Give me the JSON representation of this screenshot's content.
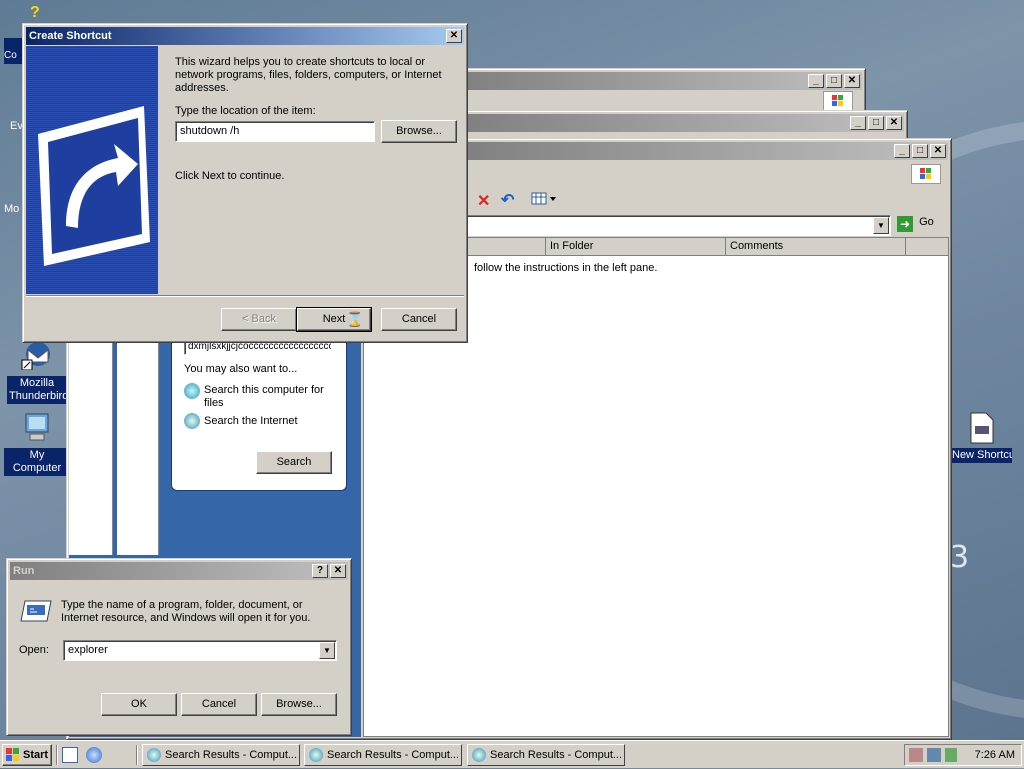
{
  "desktop": {
    "icons": [
      {
        "label": "Mozilla Thunderbird"
      },
      {
        "label": "My Computer"
      },
      {
        "label": "New Shortcut"
      }
    ],
    "partial_labels": [
      "Co",
      "Ev",
      "Mo"
    ],
    "background_digit": "3"
  },
  "search_windows": {
    "columns": [
      "In Folder",
      "Comments"
    ],
    "go_label": "Go",
    "results_message": "follow the instructions in the left pane.",
    "left_pane": {
      "search_text": "dxmjlsxkjjcjcocccccccccccccccccc",
      "also_want": "You may also want to...",
      "link_computer": "Search this computer for files",
      "link_internet": "Search the Internet",
      "search_button": "Search"
    }
  },
  "create_shortcut": {
    "title": "Create Shortcut",
    "description": "This wizard helps you to create shortcuts to local or network programs, files, folders, computers, or Internet addresses.",
    "location_label": "Type the location of the item:",
    "location_value": "shutdown /h",
    "browse": "Browse...",
    "continue_text": "Click Next to continue.",
    "back": "< Back",
    "next": "Next",
    "cancel": "Cancel"
  },
  "run_dialog": {
    "title": "Run",
    "description": "Type the name of a program, folder, document, or Internet resource, and Windows will open it for you.",
    "open_label": "Open:",
    "open_value": "explorer",
    "ok": "OK",
    "cancel": "Cancel",
    "browse": "Browse..."
  },
  "taskbar": {
    "start": "Start",
    "tasks": [
      "Search Results - Comput...",
      "Search Results - Comput...",
      "Search Results - Comput..."
    ],
    "clock": "7:26 AM"
  },
  "colors": {
    "titlebar_active": "#0a246a",
    "window_face": "#d4d0c8",
    "wizard_banner": "#1f3fa0"
  }
}
